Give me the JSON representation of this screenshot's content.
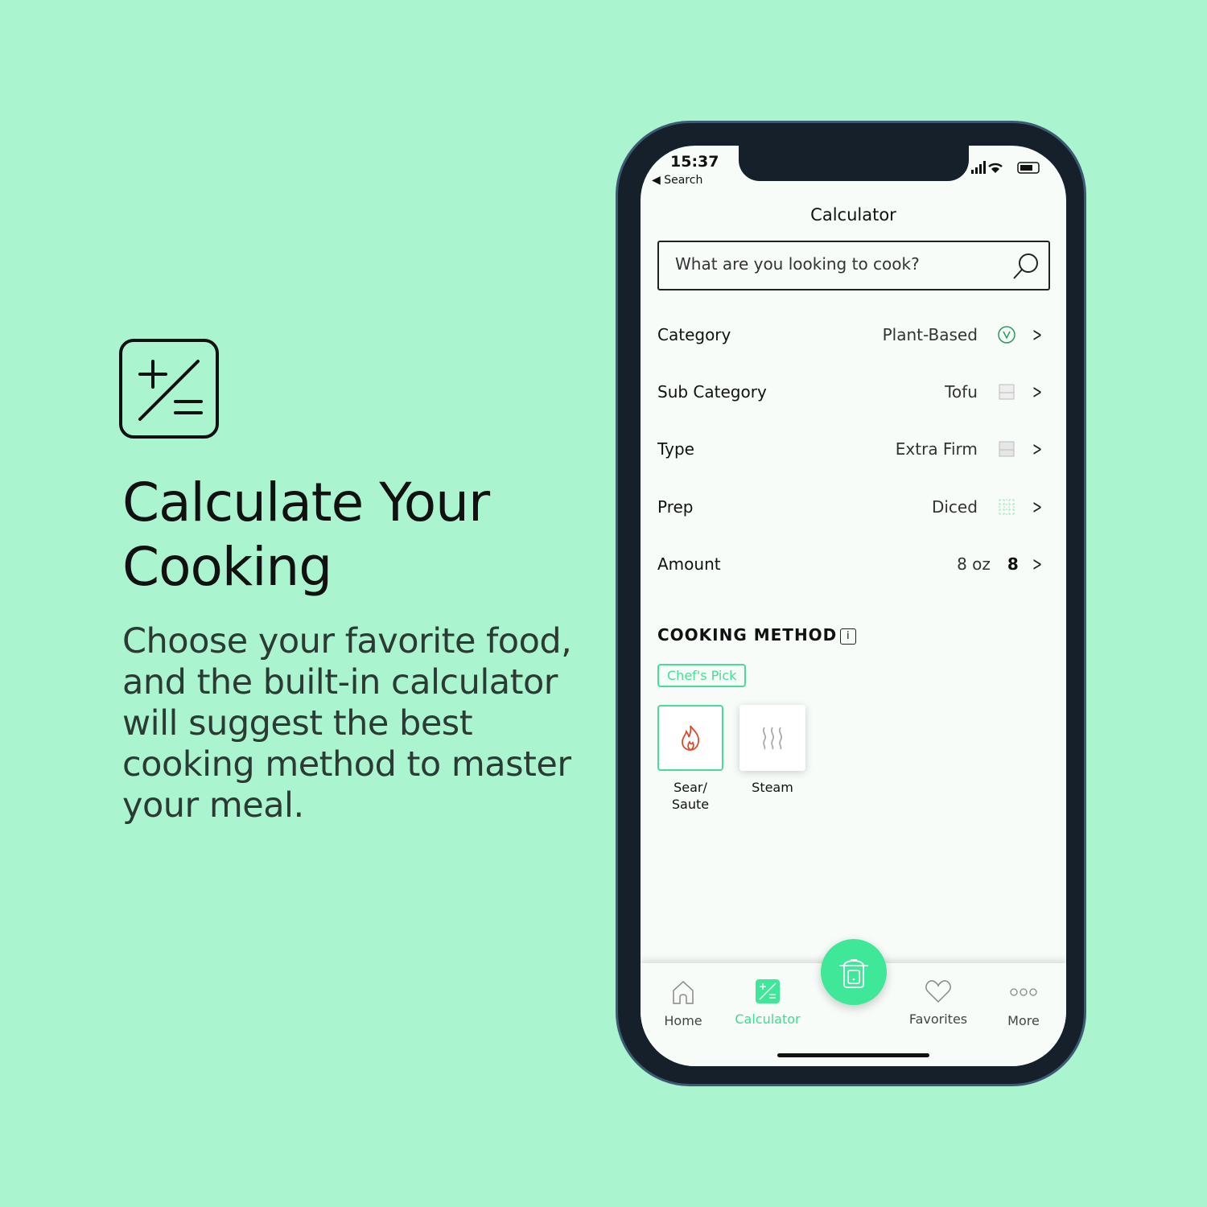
{
  "promo": {
    "headline": "Calculate Your Cooking",
    "description": "Choose your favorite food, and the built-in calculator will suggest the best cooking method to master your meal.",
    "icon": "plus-slash-equals-icon"
  },
  "status": {
    "time": "15:37",
    "back": "◀ Search"
  },
  "header": {
    "title": "Calculator"
  },
  "search": {
    "placeholder": "What are you looking to cook?"
  },
  "rows": [
    {
      "label": "Category",
      "value": "Plant-Based",
      "icon": "vegan-v-icon"
    },
    {
      "label": "Sub Category",
      "value": "Tofu",
      "icon": "tofu-block-icon"
    },
    {
      "label": "Type",
      "value": "Extra Firm",
      "icon": "tofu-block-icon"
    },
    {
      "label": "Prep",
      "value": "Diced",
      "icon": "diced-grid-icon"
    },
    {
      "label": "Amount",
      "value": "8 oz",
      "extra": "8"
    }
  ],
  "cooking_method": {
    "title": "COOKING METHOD",
    "info": "i",
    "badge": "Chef's Pick",
    "methods": [
      {
        "label": "Sear/ Saute",
        "icon": "flame-icon",
        "selected": true
      },
      {
        "label": "Steam",
        "icon": "steam-icon",
        "selected": false
      }
    ]
  },
  "tabs": [
    {
      "label": "Home"
    },
    {
      "label": "Calculator",
      "active": true
    },
    {
      "label": "Favorites"
    },
    {
      "label": "More"
    }
  ],
  "colors": {
    "accent": "#3ee898",
    "background": "#abf4d0",
    "flame": "#d94a2a"
  }
}
